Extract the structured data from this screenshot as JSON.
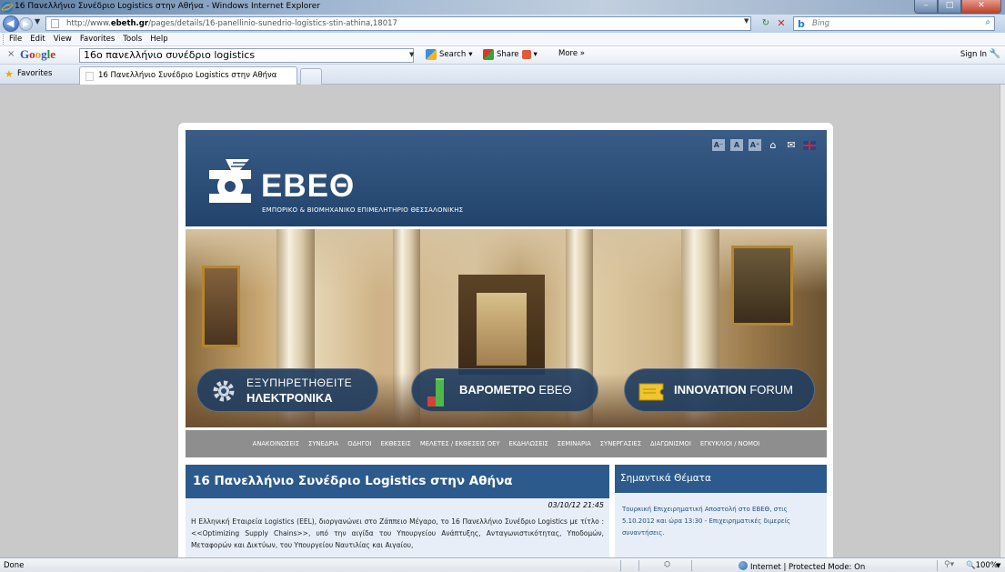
{
  "window": {
    "title": "16 Πανελλήνιο Συνέδριο Logistics στην Αθήνα - Windows Internet Explorer",
    "min_glyph": "–",
    "max_glyph": "□",
    "close_glyph": "✕"
  },
  "address": {
    "url_prefix": "http://www.",
    "url_domain": "ebeth.gr",
    "url_rest": "/pages/details/16-panellinio-sunedrio-logistics-stin-athina,18017",
    "search_provider": "Bing"
  },
  "menu": [
    "File",
    "Edit",
    "View",
    "Favorites",
    "Tools",
    "Help"
  ],
  "google_toolbar": {
    "close": "×",
    "logo": [
      "G",
      "o",
      "o",
      "g",
      "l",
      "e"
    ],
    "query": "16ο πανελλήνιο συνέδριο logistics",
    "search_label": "Search",
    "share_label": "Share",
    "more_label": "More »",
    "signin_label": "Sign In"
  },
  "favorites_bar": {
    "favorites_label": "Favorites",
    "tab_title": "16 Πανελλήνιο Συνέδριο Logistics στην Αθήνα"
  },
  "site": {
    "tools": [
      "A⁻",
      "A",
      "A⁺"
    ],
    "logo_name": "ΕΒΕΘ",
    "logo_subtitle": "ΕΜΠΟΡΙΚΟ & ΒΙΟΜΗΧΑΝΙΚΟ ΕΠΙΜΕΛΗΤΗΡΙΟ ΘΕΣΣΑΛΟΝΙΚΗΣ",
    "buttons": [
      {
        "line1": "ΕΞΥΠΗΡΕΤΗΘΕΙΤΕ",
        "line2": "ΗΛΕΚΤΡΟΝΙΚΑ"
      },
      {
        "bold": "ΒΑΡΟΜΕΤΡΟ",
        "light": "ΕΒΕΘ"
      },
      {
        "bold": "INNOVATION",
        "light": "FORUM"
      }
    ],
    "nav": [
      "ΑΝΑΚΟΙΝΩΣΕΙΣ",
      "ΣΥΝΕΔΡΙΑ",
      "ΟΔΗΓΟΙ",
      "ΕΚΘΕΣΕΙΣ",
      "ΜΕΛΕΤΕΣ / ΕΚΘΕΣΕΙΣ ΟΕΥ",
      "ΕΚΔΗΛΩΣΕΙΣ",
      "ΣΕΜΙΝΑΡΙΑ",
      "ΣΥΝΕΡΓΑΣΙΕΣ",
      "ΔΙΑΓΩΝΙΣΜΟΙ",
      "ΕΓΚΥΚΛΙΟΙ / ΝΟΜΟΙ"
    ],
    "article": {
      "title": "16 Πανελλήνιο Συνέδριο Logistics στην Αθήνα",
      "date": "03/10/12 21:45",
      "text": "Η Ελληνική Εταιρεία Logistics (EEL), διοργανώνει στο Ζάππειο Μέγαρο, το 16 Πανελλήνιο Συνέδριο Logistics με τίτλο : <<Optimizing Supply Chains>>, υπό την αιγίδα του Υπουργείου Ανάπτυξης, Ανταγωνιστικότητας, Υποδομών, Μεταφορών και Δικτύων, του Υπουργείου Ναυτιλίας και Αιγαίου,"
    },
    "sidebar": {
      "title": "Σημαντικά Θέματα",
      "item": "Τουρκική Επιχειρηματική Αποστολή στο ΕΒΕΘ, στις 5.10.2012 και ώρα 13:30 - Επιχειρηματικές διμερείς συναντήσεις."
    }
  },
  "status": {
    "text": "Done",
    "zone": "Internet | Protected Mode: On",
    "zoom": "100%"
  }
}
